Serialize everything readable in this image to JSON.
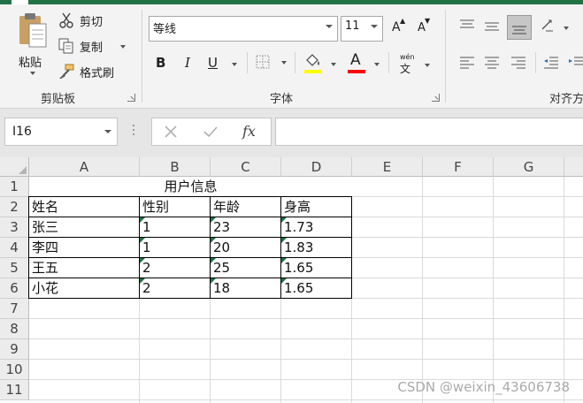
{
  "clipboard": {
    "paste_label": "粘贴",
    "cut_label": "剪切",
    "copy_label": "复制",
    "format_painter_label": "格式刷",
    "group_label": "剪贴板"
  },
  "font": {
    "name": "等线",
    "size": "11",
    "group_label": "字体",
    "bold": "B",
    "italic": "I",
    "underline": "U",
    "grow": "A",
    "shrink": "A",
    "phonetic": "wén",
    "highlight_color": "#ffff00",
    "font_color": "#ff0000"
  },
  "alignment": {
    "group_label": "对齐方"
  },
  "formula_bar": {
    "name_box": "I16",
    "fx": "fx",
    "formula": ""
  },
  "columns": [
    "A",
    "B",
    "C",
    "D",
    "E",
    "F",
    "G"
  ],
  "rows": [
    "1",
    "2",
    "3",
    "4",
    "5",
    "6",
    "7",
    "8",
    "9",
    "10",
    "11"
  ],
  "sheet": {
    "title": "用户信息",
    "headers": [
      "姓名",
      "性别",
      "年龄",
      "身高"
    ],
    "data": [
      [
        "张三",
        "1",
        "23",
        "1.73"
      ],
      [
        "李四",
        "1",
        "20",
        "1.83"
      ],
      [
        "王五",
        "2",
        "25",
        "1.65"
      ],
      [
        "小花",
        "2",
        "18",
        "1.65"
      ]
    ]
  },
  "watermark": "CSDN @weixin_43606738",
  "colors": {
    "excel_green": "#217346",
    "error_triangle": "#1e7145"
  }
}
